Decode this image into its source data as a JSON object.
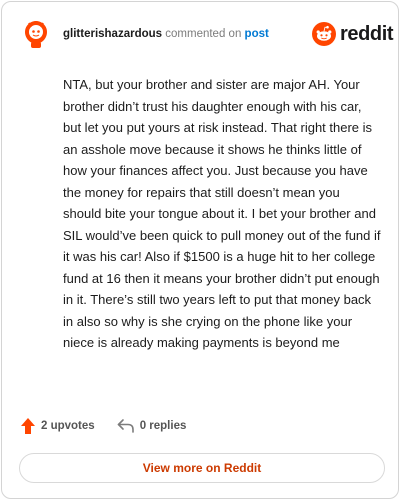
{
  "comment": {
    "username": "glitterishazardous",
    "action_text": "commented on",
    "link_text": "post"
  },
  "brand": {
    "logo_text": "reddit",
    "logo_icon": "reddit-alien-icon",
    "accent_color": "#ff4500"
  },
  "body": {
    "text": "NTA, but your brother and sister are major AH. Your brother didn’t trust his daughter enough with his car, but let you put yours at risk instead. That right there is an asshole move because it shows he thinks little of how your finances affect you. Just because you have the money for repairs that still doesn’t mean you should bite your tongue about it. I bet your brother and SIL would’ve been quick to pull money out of the fund if it was his car! Also if $1500 is a huge hit to her college fund at 16 then it means your brother didn’t put enough in it. There’s still two years left to put that money back in also so why is she crying on the phone like your niece is already making payments is beyond me"
  },
  "stats": {
    "upvotes_label": "2 upvotes",
    "replies_label": "0 replies",
    "upvote_icon": "upvote-arrow-icon",
    "reply_icon": "reply-arrow-icon"
  },
  "footer": {
    "view_more_label": "View more on Reddit"
  }
}
